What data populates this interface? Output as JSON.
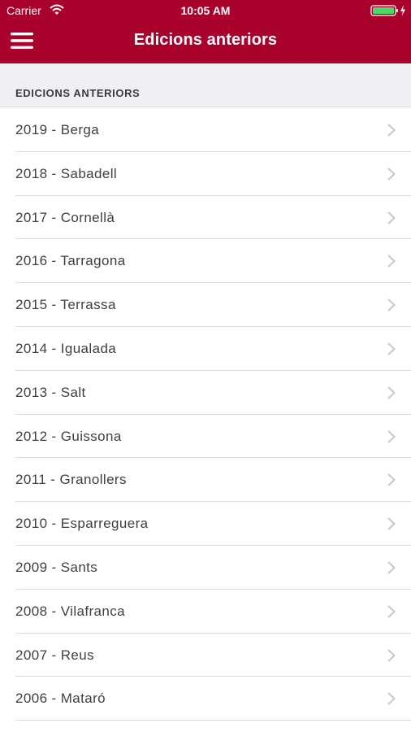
{
  "status_bar": {
    "carrier": "Carrier",
    "time": "10:05 AM",
    "icons": [
      "wifi-icon",
      "battery-icon"
    ]
  },
  "nav_bar": {
    "title": "Edicions anteriors",
    "menu_icon": "hamburger-menu-icon",
    "color": "#a8022d"
  },
  "section": {
    "title": "EDICIONS ANTERIORS"
  },
  "editions": [
    {
      "label": "2019 - Berga"
    },
    {
      "label": "2018 - Sabadell"
    },
    {
      "label": "2017 - Cornellà"
    },
    {
      "label": "2016 - Tarragona"
    },
    {
      "label": "2015 - Terrassa"
    },
    {
      "label": "2014 - Igualada"
    },
    {
      "label": "2013 - Salt"
    },
    {
      "label": "2012 - Guissona"
    },
    {
      "label": "2011 - Granollers"
    },
    {
      "label": "2010 - Esparreguera"
    },
    {
      "label": "2009 - Sants"
    },
    {
      "label": "2008 - Vilafranca"
    },
    {
      "label": "2007 - Reus"
    },
    {
      "label": "2006 - Mataró"
    }
  ]
}
